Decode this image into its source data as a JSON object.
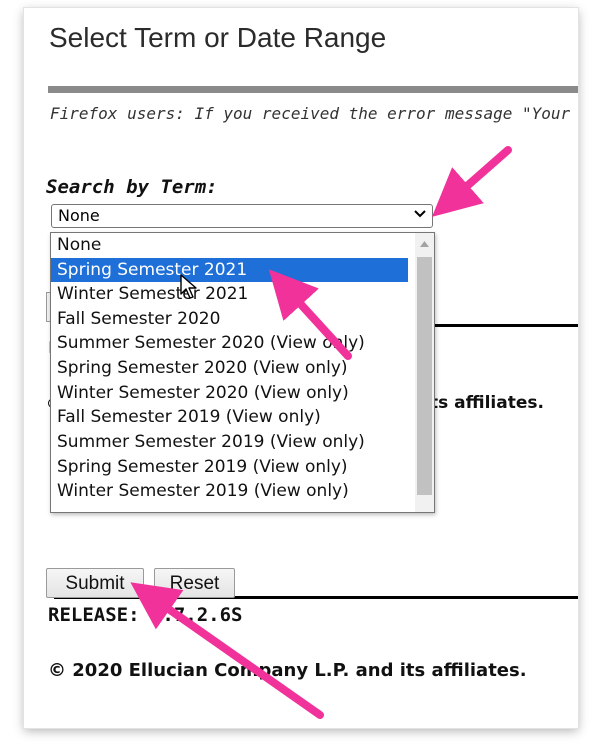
{
  "page": {
    "title": "Select Term or Date Range",
    "notice": "Firefox users: If you received the error message \"Your"
  },
  "search": {
    "label": "Search by Term:",
    "selected_value": "None"
  },
  "dropdown": {
    "options": [
      "None",
      "Spring Semester 2021",
      "Winter Semester 2021",
      "Fall Semester 2020",
      "Summer Semester 2020 (View only)",
      "Spring Semester 2020 (View only)",
      "Winter Semester 2020 (View only)",
      "Fall Semester 2019 (View only)",
      "Summer Semester 2019 (View only)",
      "Spring Semester 2019 (View only)",
      "Winter Semester 2019 (View only)"
    ],
    "highlighted": "Spring Semester 2021"
  },
  "behind": {
    "partial_letter": "L",
    "partial_letter_2": "©",
    "affiliates_fragment": "ts affiliates."
  },
  "buttons": {
    "submit": "Submit",
    "reset": "Reset"
  },
  "footer": {
    "release": "RELEASE: 8.7.2.6S",
    "copyright": "© 2020 Ellucian Company L.P. and its affiliates."
  },
  "colors": {
    "highlight": "#1e6fd8",
    "annotation_arrow": "#f0329a"
  },
  "icons": {
    "select_chevron": "chevron-down-icon",
    "mouse_cursor": "mouse-pointer-icon",
    "annotation": "annotation-arrow"
  }
}
